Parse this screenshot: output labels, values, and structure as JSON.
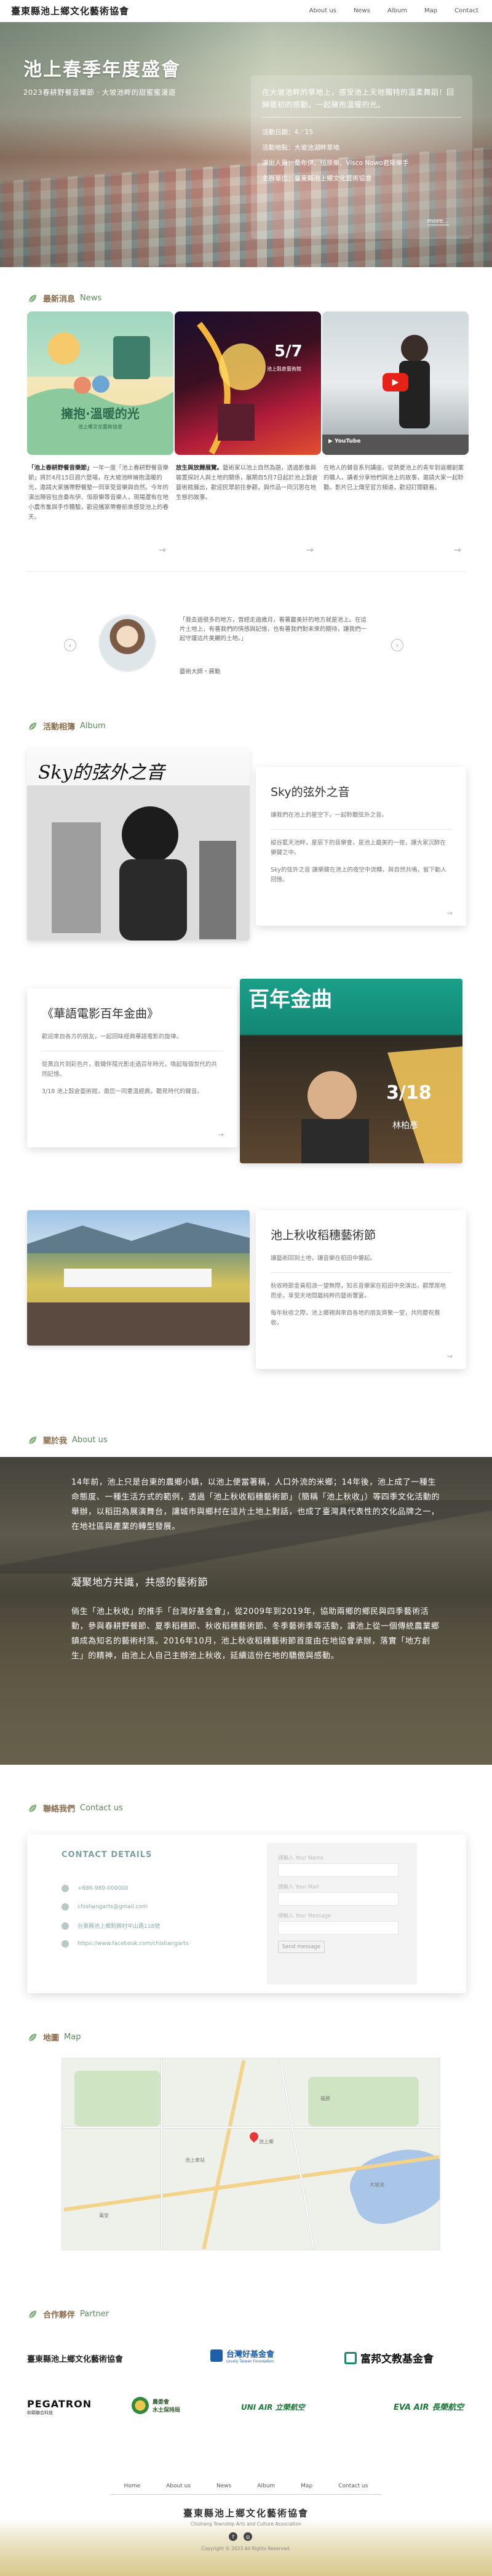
{
  "header": {
    "brand": "臺東縣池上鄉文化藝術協會",
    "nav": [
      "About us",
      "News",
      "Album",
      "Map",
      "Contact"
    ]
  },
  "hero": {
    "title": "池上春季年度盛會",
    "subtitle": "2023春耕野餐音樂節 · 大坡池畔的甜蜜蜜漫遊",
    "intro": "在大坡池畔的草地上，感受池上天地獨特的溫柔舞蹈！回歸最初的感動，一起擁抱溫暖的光。",
    "date": "活動日期：4／15",
    "place": "活動地點：大坡池湖畔草地",
    "performers": "演出人員：桑布伊、恒原樂、Visco Nowo君陽樂手",
    "host": "主辦單位：臺東縣池上鄉文化藝術協會",
    "more": "more..."
  },
  "news": {
    "title_zh": "最新消息",
    "title_en": "News",
    "cards": [
      {
        "img_title": "擁抱·溫暖的光",
        "img_sub": "池上鄉文化藝術協會",
        "lead": "「池上春耕野餐音樂節」",
        "text": "一年一度「池上春耕野餐音樂節」將於4月15日週六登場，在大坡池畔擁抱溫暖的光，邀請大家攜帶野餐墊一同享受音樂與自然。今年的演出陣容包含桑布伊、恒原樂等音樂人，現場還有在地小農市集與手作體驗，歡迎攜家帶眷前來感受池上的春天。"
      },
      {
        "img_title": "5/7",
        "img_sub": "池上穀倉藝術館",
        "lead": "放生與放歸展覽。",
        "text": "藝術家以池上自然為題，透過影像與裝置探討人與土地的關係，展期自5月7日起於池上穀倉藝術館展出，歡迎民眾前往參觀，與作品一同沉思在地生態的故事。"
      },
      {
        "img_title": "",
        "img_sub": "",
        "lead": "",
        "text": "在地人的聲音系列講座。從熱愛池上的青年到返鄉創業的職人，講者分享他們與池上的故事，邀請大家一起聆聽。影片已上傳至官方頻道，歡迎訂閱觀看。"
      }
    ]
  },
  "quote": {
    "text": "「我去過很多的地方，曾經走過歲月，看著最美好的地方就是池上。在這片土地上，有著我們的情感與記憶，也有著我們對未來的期待，讓我們一起守護這片美麗的土地。」",
    "by": "藝術大師・蔣勳"
  },
  "album": {
    "title_zh": "活動相簿",
    "title_en": "Album",
    "items": [
      {
        "title": "Sky的弦外之音",
        "p1": "讓我們在池上的星空下，一起聆聽弦外之音。",
        "p2": "縱谷藍天池畔，星辰下的音樂會，是池上最美的一夜，讓大家沉醉在樂聲之中。",
        "p3": "Sky的弦外之音 讓樂聲在池上的夜空中流轉，與自然共鳴，留下動人回憶。",
        "img_text": "Sky的弦外之音"
      },
      {
        "title": "《華語電影百年金曲》",
        "p1": "歡迎來自各方的朋友，一起回味經典華語電影的旋律。",
        "p2": "從黑白片到彩色片，歌聲伴隨光影走過百年時光，喚起每個世代的共同記憶。",
        "p3": "3/18 池上穀倉藝術館，邀您一同重溫經典，聽見時代的聲音。",
        "img_text": "百年金曲",
        "date": "3/18",
        "performer": "林柏彥"
      },
      {
        "title": "池上秋收稻穗藝術節",
        "p1": "讓藝術回到土地，讓音樂在稻田中響起。",
        "p2": "秋收時節金黃稻浪一望無際，知名音樂家在稻田中央演出，觀眾席地而坐，享受天地間最純粹的藝術饗宴。",
        "p3": "每年秋收之際，池上鄉親與來自各地的朋友齊聚一堂，共同慶祝豐收。"
      }
    ]
  },
  "about": {
    "title_zh": "關於我",
    "title_en": "About us",
    "p1": "14年前，池上只是台東的農鄉小鎮，以池上便當著稱，人口外流的米鄉；14年後，池上成了一種生命態度、一種生活方式的範例，透過「池上秋收稻穗藝術節」（簡稱「池上秋收」）等四季文化活動的舉辦，以稻田為展演舞台，讓城市與鄉村在這片土地上對話，也成了臺灣具代表性的文化品牌之一，在地社區與產業的轉型發展。",
    "head": "凝聚地方共識，共感的藝術節",
    "p2": "倘生「池上秋收」的推手「台灣好基金會」，從2009年到2019年，協助兩鄉的鄉民與四季藝術活動，參與春耕野餐節、夏季稻穗節、秋收稻穗藝術節、冬季藝術季等活動，讓池上從一個傳統農業鄉鎮成為知名的藝術村落。2016年10月，池上秋收稻穗藝術節首度由在地協會承辦，落實「地方創生」的精神，由池上人自己主辦池上秋收，延續這份在地的驕傲與感動。"
  },
  "contact": {
    "title_zh": "聯絡我們",
    "title_en": "Contact us",
    "heading": "CONTACT DETAILS",
    "phone": "+886-989-000000",
    "email": "chishangarts@gmail.com",
    "address": "台東縣池上鄉新興村中山路118號",
    "facebook": "https://www.facebook.com/chishangarts",
    "form_name": "請輸入 Your Name",
    "form_mail": "請輸入 Your Mail",
    "form_msg": "請輸入 Your Message",
    "send": "Send message"
  },
  "map": {
    "title_zh": "地圖",
    "title_en": "Map",
    "labels": [
      "池上鄉",
      "大坡池",
      "池上車站",
      "萬安",
      "福原"
    ]
  },
  "partner": {
    "title_zh": "合作夥伴",
    "title_en": "Partner",
    "items": [
      {
        "name": "臺東縣池上鄉文化藝術協會"
      },
      {
        "name": "台灣好基金會",
        "en": "Lovely Taiwan Foundation"
      },
      {
        "name": "富邦文教基金會"
      },
      {
        "name": "PEGATRON",
        "sub": "和碩聯合科技"
      },
      {
        "name": "農委會",
        "sub": "水土保持局"
      },
      {
        "name": "UNI AIR 立榮航空"
      },
      {
        "name": "EVA AIR 長榮航空"
      }
    ]
  },
  "footer": {
    "nav": [
      "Home",
      "About us",
      "News",
      "Album",
      "Map",
      "Contact us"
    ],
    "brand": "臺東縣池上鄉文化藝術協會",
    "en": "Chishang Township Arts and Culture Association",
    "copyright": "Copyright © 2023 All Rights Reserved."
  },
  "colors": {
    "section_green": "#5a8a5a",
    "section_brown": "#8a6d4c",
    "contact_accent": "#7aa0a6"
  }
}
